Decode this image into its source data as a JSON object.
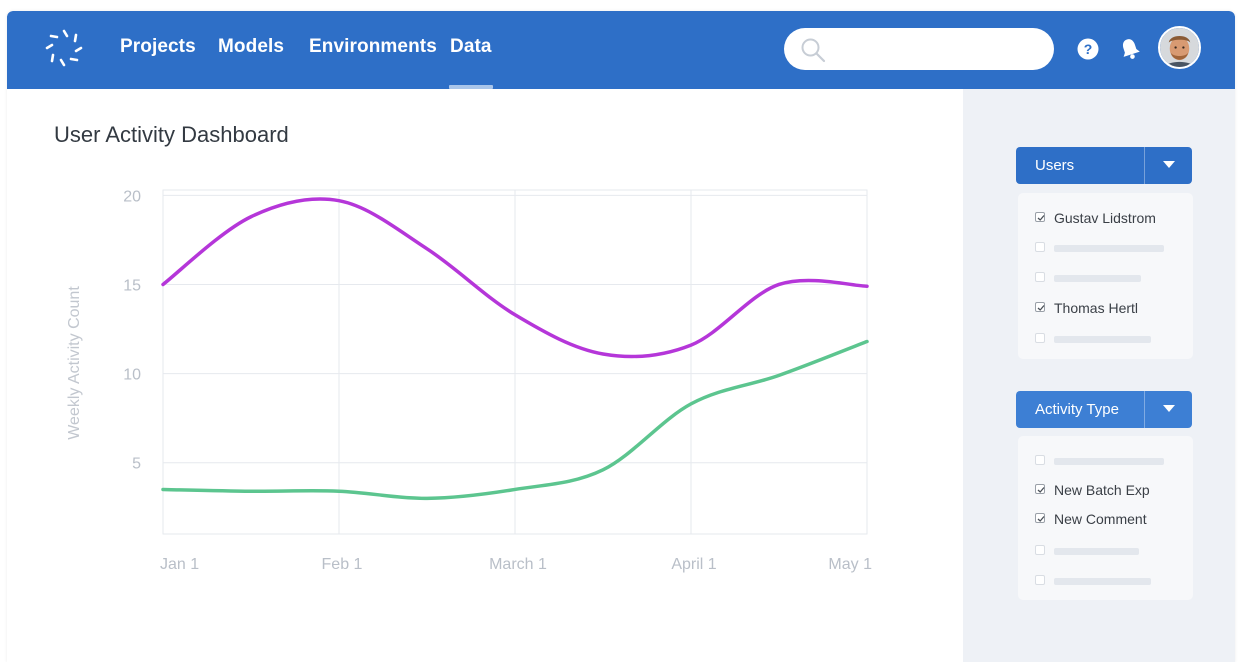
{
  "nav": {
    "items": [
      "Projects",
      "Models",
      "Environments",
      "Data"
    ],
    "active": "Data"
  },
  "search": {
    "placeholder": ""
  },
  "header_icons": [
    "logo-icon",
    "search-icon",
    "help-icon",
    "bell-icon",
    "avatar"
  ],
  "page": {
    "title": "User Activity Dashboard"
  },
  "colors": {
    "brand": "#2e6fc7",
    "series_purple": "#b536d9",
    "series_green": "#5cc58f",
    "sidebar_bg": "#eef1f6"
  },
  "chart_data": {
    "type": "line",
    "title": "",
    "xlabel": "",
    "ylabel": "Weekly Activity Count",
    "x_ticks": [
      "Jan 1",
      "Feb 1",
      "March 1",
      "April 1",
      "May 1"
    ],
    "y_ticks": [
      5,
      10,
      15,
      20
    ],
    "ylim": [
      1,
      20.3
    ],
    "grid": true,
    "legend": "none",
    "x": [
      "Jan 1",
      "Jan 15",
      "Feb 1",
      "Feb 15",
      "March 1",
      "March 15",
      "April 1",
      "April 15",
      "May 1"
    ],
    "series": [
      {
        "color": "#b536d9",
        "values": [
          15.0,
          18.8,
          19.7,
          17.0,
          13.3,
          11.1,
          11.6,
          15.0,
          14.9
        ]
      },
      {
        "color": "#5cc58f",
        "values": [
          3.5,
          3.4,
          3.4,
          3.0,
          3.5,
          4.6,
          8.3,
          9.9,
          11.8
        ]
      }
    ]
  },
  "sidebar": {
    "users": {
      "label": "Users",
      "options": [
        {
          "label": "Gustav Lidstrom",
          "checked": true
        },
        {
          "label": "",
          "checked": false
        },
        {
          "label": "",
          "checked": false
        },
        {
          "label": "Thomas Hertl",
          "checked": true
        },
        {
          "label": "",
          "checked": false
        }
      ]
    },
    "activity": {
      "label": "Activity Type",
      "options": [
        {
          "label": "",
          "checked": false
        },
        {
          "label": "New Batch Exp",
          "checked": true
        },
        {
          "label": "New Comment",
          "checked": true
        },
        {
          "label": "",
          "checked": false
        },
        {
          "label": "",
          "checked": false
        }
      ]
    }
  }
}
